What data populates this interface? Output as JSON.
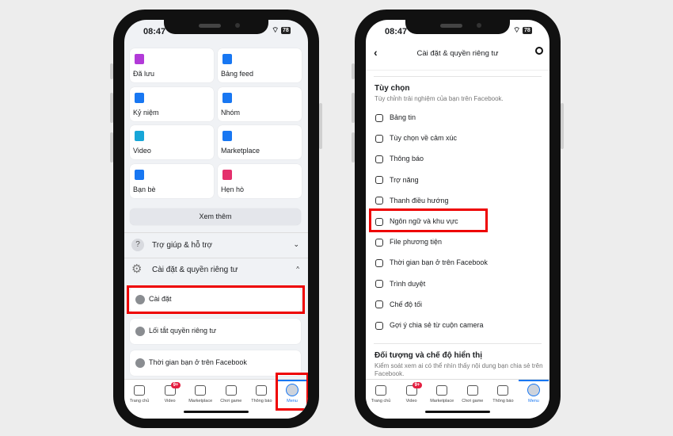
{
  "status": {
    "time": "08:47",
    "battery": "78"
  },
  "left": {
    "shortcuts": [
      {
        "label": "Đã lưu",
        "icon": "bookmark-icon",
        "color": "#b23ad8"
      },
      {
        "label": "Bảng feed",
        "icon": "feed-icon",
        "color": "#1877f2"
      },
      {
        "label": "Kỷ niệm",
        "icon": "memories-icon",
        "color": "#1877f2"
      },
      {
        "label": "Nhóm",
        "icon": "groups-icon",
        "color": "#1877f2"
      },
      {
        "label": "Video",
        "icon": "video-icon",
        "color": "#17a6d8"
      },
      {
        "label": "Marketplace",
        "icon": "marketplace-icon",
        "color": "#1877f2"
      },
      {
        "label": "Bạn bè",
        "icon": "friends-icon",
        "color": "#1877f2"
      },
      {
        "label": "Hẹn hò",
        "icon": "heart-icon",
        "color": "#e4306c"
      }
    ],
    "see_more": "Xem thêm",
    "help": "Trợ giúp & hỗ trợ",
    "settings_section": "Cài đặt & quyền riêng tư",
    "settings_items": [
      "Cài đặt",
      "Lối tắt quyền riêng tư",
      "Thời gian bạn ở trên Facebook"
    ]
  },
  "right": {
    "title": "Cài đặt & quyền riêng tư",
    "section1": {
      "title": "Tùy chọn",
      "subtitle": "Tùy chỉnh trải nghiệm của bạn trên Facebook."
    },
    "items": [
      {
        "label": "Bảng tin",
        "icon": "sliders-icon"
      },
      {
        "label": "Tùy chọn về cảm xúc",
        "icon": "reaction-icon"
      },
      {
        "label": "Thông báo",
        "icon": "bell-icon"
      },
      {
        "label": "Trợ năng",
        "icon": "accessibility-icon"
      },
      {
        "label": "Thanh điều hướng",
        "icon": "pin-icon"
      },
      {
        "label": "Ngôn ngữ và khu vực",
        "icon": "globe-icon"
      },
      {
        "label": "File phương tiện",
        "icon": "media-file-icon"
      },
      {
        "label": "Thời gian bạn ở trên Facebook",
        "icon": "clock-icon"
      },
      {
        "label": "Trình duyệt",
        "icon": "browser-icon"
      },
      {
        "label": "Chế độ tối",
        "icon": "moon-icon"
      },
      {
        "label": "Gợi ý chia sẻ từ cuộn camera",
        "icon": "camera-icon"
      }
    ],
    "section2": {
      "title": "Đối tượng và chế độ hiển thị",
      "subtitle": "Kiểm soát xem ai có thể nhìn thấy nội dung bạn chia sẻ trên Facebook."
    }
  },
  "nav": {
    "items": [
      "Trang chủ",
      "Video",
      "Marketplace",
      "Chơi game",
      "Thông báo",
      "Menu"
    ],
    "badge": "9+",
    "active": "Menu"
  },
  "colors": {
    "accent": "#1877f2",
    "highlight": "#e00000",
    "badge": "#e41e3f"
  }
}
